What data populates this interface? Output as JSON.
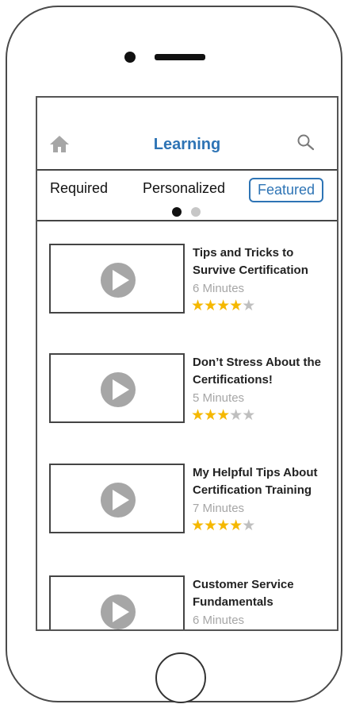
{
  "header": {
    "title": "Learning",
    "home_icon": "home-icon",
    "search_icon": "search-icon"
  },
  "tabs": [
    {
      "label": "Required",
      "selected": false
    },
    {
      "label": "Personalized",
      "selected": false
    },
    {
      "label": "Featured",
      "selected": true
    }
  ],
  "pager": {
    "current": 1,
    "total": 2
  },
  "videos": [
    {
      "title": "Tips and Tricks to Survive Certification",
      "duration": "6 Minutes",
      "rating": 4
    },
    {
      "title": "Don’t Stress About the Certifications!",
      "duration": "5 Minutes",
      "rating": 3
    },
    {
      "title": "My Helpful Tips About Certification Training",
      "duration": "7 Minutes",
      "rating": 4
    },
    {
      "title": "Customer Service Fundamentals",
      "duration": "6 Minutes",
      "rating": 0
    }
  ],
  "colors": {
    "accent": "#2e74b5",
    "star_on": "#f5b800",
    "star_off": "#bfbfbf",
    "muted_text": "#a6a6a6",
    "play_icon": "#a6a6a6"
  }
}
